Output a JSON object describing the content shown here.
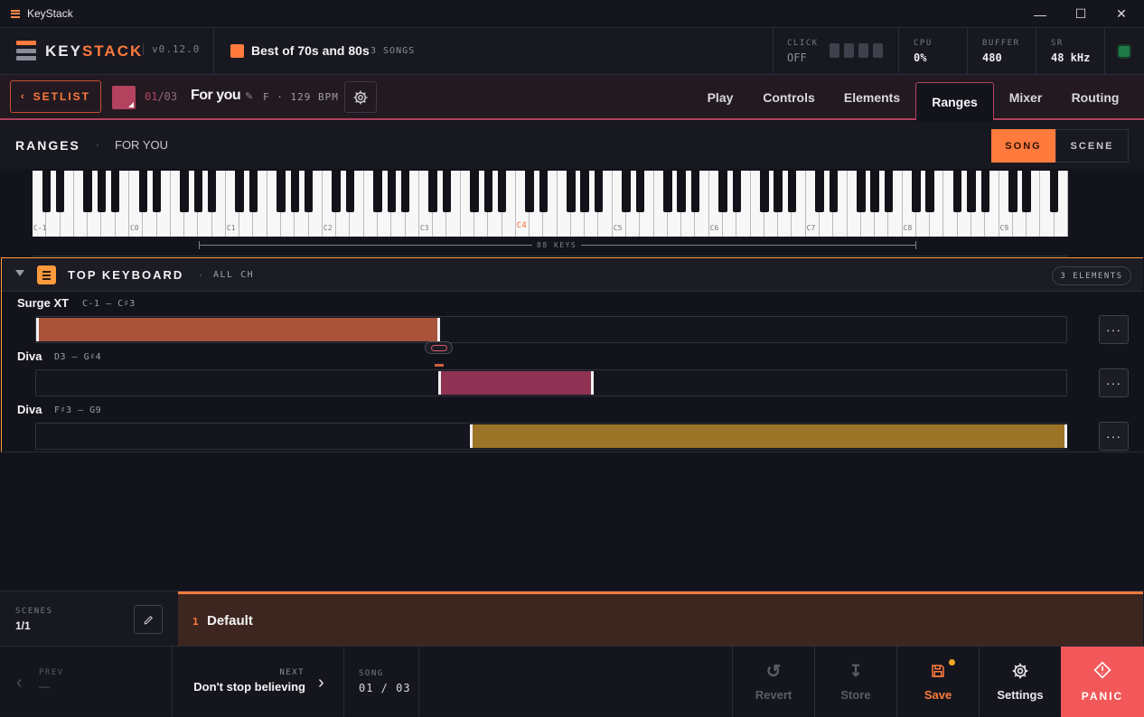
{
  "window": {
    "title": "KeyStack",
    "minimize": "—",
    "maximize": "☐",
    "close": "✕"
  },
  "header": {
    "logo_key": "KEY",
    "logo_stack": "STACK",
    "version": "v0.12.0",
    "setlist_name": "Best of 70s and 80s",
    "setlist_count": "3 SONGS",
    "click_label": "CLICK",
    "click_value": "OFF",
    "cpu_label": "CPU",
    "cpu_value": "0%",
    "buffer_label": "BUFFER",
    "buffer_value": "480",
    "sr_label": "SR",
    "sr_value": "48 kHz"
  },
  "songbar": {
    "setlist_button": "SETLIST",
    "song_index": "01",
    "song_total": "/03",
    "song_title": "For you",
    "song_meta": "F · 129 BPM"
  },
  "tabs": [
    {
      "label": "Play"
    },
    {
      "label": "Controls"
    },
    {
      "label": "Elements"
    },
    {
      "label": "Ranges"
    },
    {
      "label": "Mixer"
    },
    {
      "label": "Routing"
    }
  ],
  "ranges": {
    "title": "RANGES",
    "separator": "·",
    "song": "FOR YOU",
    "mode_song": "SONG",
    "mode_scene": "SCENE",
    "keys_label": "88 KEYS",
    "octave_labels": [
      "C-1",
      "C0",
      "C1",
      "C2",
      "C3",
      "C4",
      "C5",
      "C6",
      "C7",
      "C8",
      "C9"
    ]
  },
  "group": {
    "title": "TOP KEYBOARD",
    "separator": "·",
    "channel": "ALL CH",
    "badge": "3 ELEMENTS",
    "elements": [
      {
        "name": "Surge XT",
        "range": "C-1 — C♯3",
        "color": "#a9533a"
      },
      {
        "name": "Diva",
        "range": "D3 — G♯4",
        "color": "#8e3353"
      },
      {
        "name": "Diva",
        "range": "F♯3 — G9",
        "color": "#9c7428"
      }
    ],
    "more": "···"
  },
  "scenes": {
    "label": "SCENES",
    "count": "1/1",
    "current_num": "1",
    "current_name": "Default"
  },
  "footer": {
    "prev_label": "PREV",
    "prev_value": "—",
    "next_label": "NEXT",
    "next_value": "Don't stop believing",
    "song_label": "SONG",
    "song_value": "01 / 03",
    "revert": "Revert",
    "store": "Store",
    "save": "Save",
    "settings": "Settings",
    "panic": "PANIC"
  }
}
